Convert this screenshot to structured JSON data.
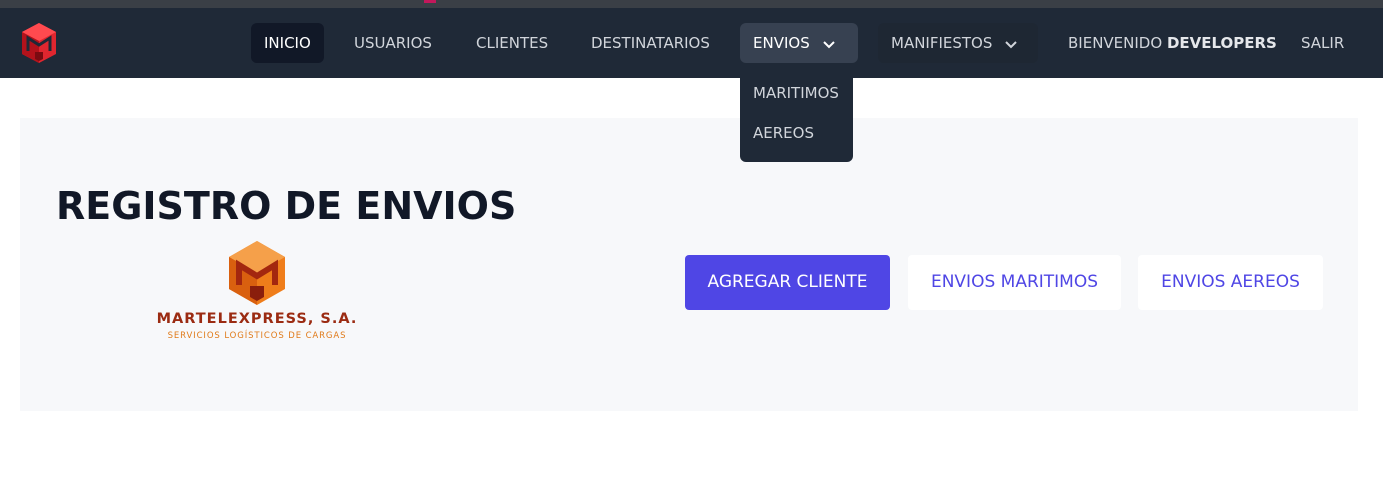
{
  "nav": {
    "items": [
      {
        "label": "INICIO"
      },
      {
        "label": "USUARIOS"
      },
      {
        "label": "CLIENTES"
      },
      {
        "label": "DESTINATARIOS"
      },
      {
        "label": "ENVIOS"
      },
      {
        "label": "MANIFIESTOS"
      }
    ],
    "welcome_prefix": "BIENVENIDO",
    "welcome_user": "DEVELOPERS",
    "logout_label": "SALIR"
  },
  "envios_dropdown": {
    "items": [
      {
        "label": "MARITIMOS"
      },
      {
        "label": "AEREOS"
      }
    ]
  },
  "main": {
    "title": "REGISTRO DE ENVIOS",
    "brand": {
      "name": "MARTELEXPRESS, S.A.",
      "tagline": "SERVICIOS LOGÍSTICOS DE CARGAS"
    },
    "buttons": {
      "add_client": "AGREGAR CLIENTE",
      "maritime": "ENVIOS MARITIMOS",
      "air": "ENVIOS AEREOS"
    }
  },
  "colors": {
    "navbar": "#1f2937",
    "accent": "#4f46e5",
    "panel": "#f7f8fa",
    "brand_red": "#9b2b12",
    "brand_orange": "#e07b1a",
    "logo_red": "#e0262f"
  },
  "icons": {
    "nav_logo": "martel-logo-icon",
    "chevron": "chevron-down-icon",
    "brand_mark": "martel-brand-mark-icon"
  }
}
